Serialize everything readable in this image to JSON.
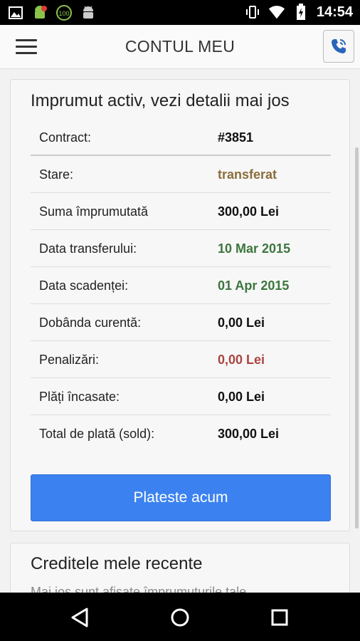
{
  "statusbar": {
    "time": "14:54",
    "icons_left": [
      "image-icon",
      "android-alert-icon",
      "battery-100-icon",
      "android-icon"
    ],
    "icons_right": [
      "vibrate-icon",
      "wifi-icon",
      "battery-charging-icon"
    ]
  },
  "appbar": {
    "title": "CONTUL MEU"
  },
  "loan_card": {
    "title": "Imprumut activ, vezi detalii mai jos",
    "rows": [
      {
        "label": "Contract:",
        "value": "#3851",
        "color": "#111111"
      },
      {
        "label": "Stare:",
        "value": "transferat",
        "color": "#8a6d3b"
      },
      {
        "label": "Suma împrumutată",
        "value": "300,00 Lei",
        "color": "#111111"
      },
      {
        "label": "Data transferului:",
        "value": "10 Mar 2015",
        "color": "#3c763d"
      },
      {
        "label": "Data scadenței:",
        "value": "01 Apr 2015",
        "color": "#3c763d"
      },
      {
        "label": "Dobânda curentă:",
        "value": "0,00 Lei",
        "color": "#111111"
      },
      {
        "label": "Penalizări:",
        "value": "0,00 Lei",
        "color": "#a94442"
      },
      {
        "label": "Plăți încasate:",
        "value": "0,00 Lei",
        "color": "#111111"
      },
      {
        "label": "Total de plată (sold):",
        "value": "300,00 Lei",
        "color": "#111111"
      }
    ],
    "pay_button": "Plateste acum"
  },
  "recent_card": {
    "title": "Creditele mele recente",
    "subtitle": "Mai jos sunt afișate împrumuturile tale"
  },
  "colors": {
    "accent": "#3b82f0"
  }
}
